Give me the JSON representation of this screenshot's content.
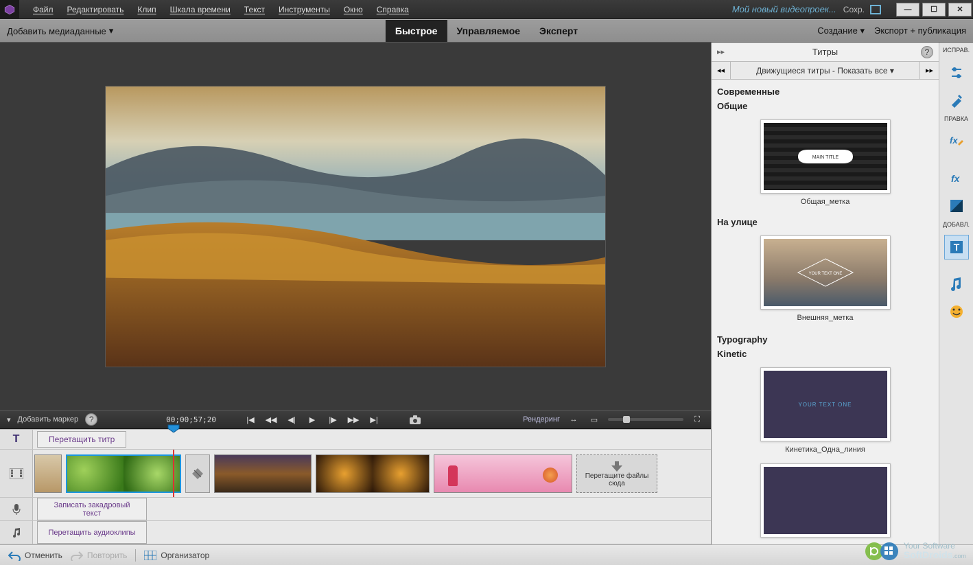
{
  "menu": [
    "Файл",
    "Редактировать",
    "Клип",
    "Шкала времени",
    "Текст",
    "Инструменты",
    "Окно",
    "Справка"
  ],
  "project_title": "Мой новый видеопроек...",
  "save_label": "Сохр.",
  "subbar": {
    "add_media": "Добавить медиаданные",
    "modes": [
      "Быстрое",
      "Управляемое",
      "Эксперт"
    ],
    "active_mode": 0,
    "create": "Создание",
    "export": "Экспорт + публикация"
  },
  "playback": {
    "add_marker": "Добавить маркер",
    "timecode": "00;00;57;20",
    "rendering": "Рендеринг"
  },
  "tracks": {
    "title_icon": "T",
    "drag_title": "Перетащить титр",
    "drop_here": "Перетащите файлы сюда",
    "record_narration": "Записать закадровый текст",
    "drag_audio": "Перетащить аудиоклипы"
  },
  "footer": {
    "undo": "Отменить",
    "redo": "Повторить",
    "organizer": "Организатор"
  },
  "panel": {
    "title": "Титры",
    "fix_label": "ИСПРАВ.",
    "edit_label": "ПРАВКА",
    "add_label": "ДОБАВЛ.",
    "nav": "Движущиеся титры - Показать все",
    "sections": [
      {
        "h1": "Современные",
        "h2": "Общие",
        "thumb_caption": "Общая_метка",
        "thumb_text": "MAIN TITLE"
      },
      {
        "h2": "На улице",
        "thumb_caption": "Внешняя_метка",
        "thumb_text": "YOUR TEXT ONE"
      },
      {
        "h1": "Typography",
        "h2": "Kinetic",
        "thumb_caption": "Кинетика_Одна_линия",
        "thumb_text": "YOUR TEXT ONE"
      }
    ]
  },
  "watermark": {
    "line1": "Your Software",
    "line2": "SoftDroids"
  }
}
